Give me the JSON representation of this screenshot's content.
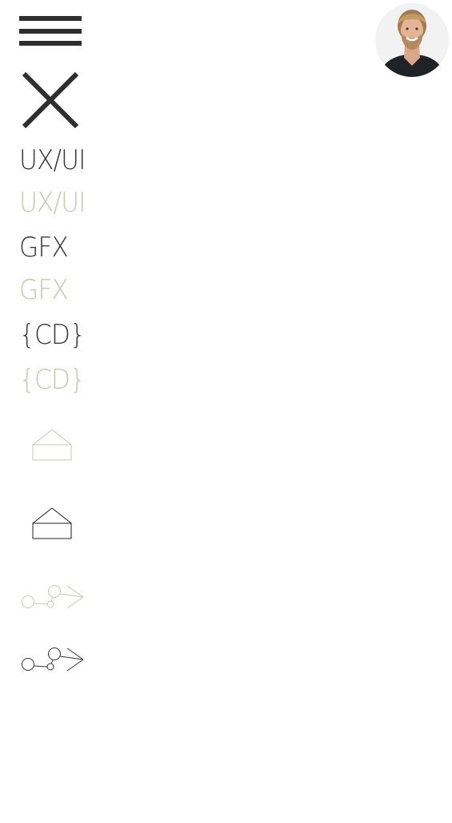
{
  "header": {
    "menu_icon": "hamburger-icon",
    "close_icon": "close-icon",
    "avatar_icon": "profile-avatar"
  },
  "menu": {
    "items": [
      {
        "label": "UX/UI",
        "state": "active"
      },
      {
        "label": "UX/UI",
        "state": "inactive"
      },
      {
        "label": "GFX",
        "state": "active"
      },
      {
        "label": "GFX",
        "state": "inactive"
      },
      {
        "label": "{CD}",
        "state": "active"
      },
      {
        "label": "{CD}",
        "state": "inactive"
      }
    ],
    "icons": [
      {
        "name": "mail-envelope-icon",
        "state": "inactive"
      },
      {
        "name": "mail-envelope-icon",
        "state": "active"
      },
      {
        "name": "share-network-icon",
        "state": "inactive"
      },
      {
        "name": "share-network-icon",
        "state": "active"
      }
    ]
  },
  "colors": {
    "dark": "#3a3a3a",
    "light": "#cac7b2",
    "icon_dark": "#2e2e2e"
  }
}
